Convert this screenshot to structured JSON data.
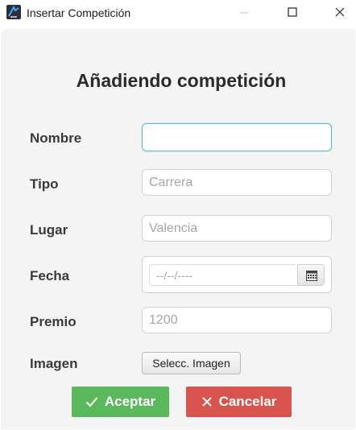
{
  "window": {
    "title": "Insertar Competición",
    "icon": "app-logo-icon"
  },
  "form": {
    "heading": "Añadiendo competición",
    "fields": {
      "nombre": {
        "label": "Nombre",
        "value": "",
        "placeholder": ""
      },
      "tipo": {
        "label": "Tipo",
        "value": "",
        "placeholder": "Carrera"
      },
      "lugar": {
        "label": "Lugar",
        "value": "",
        "placeholder": "Valencia"
      },
      "fecha": {
        "label": "Fecha",
        "value": "",
        "placeholder": "--/--/----"
      },
      "premio": {
        "label": "Premio",
        "value": "",
        "placeholder": "1200"
      },
      "imagen": {
        "label": "Imagen",
        "button_label": "Selecc. Imagen"
      }
    },
    "actions": {
      "accept_label": "Aceptar",
      "cancel_label": "Cancelar"
    }
  },
  "colors": {
    "accept": "#5cb85c",
    "cancel": "#d9534f",
    "focus": "#5fb7c9",
    "background": "#f4f4f4"
  }
}
